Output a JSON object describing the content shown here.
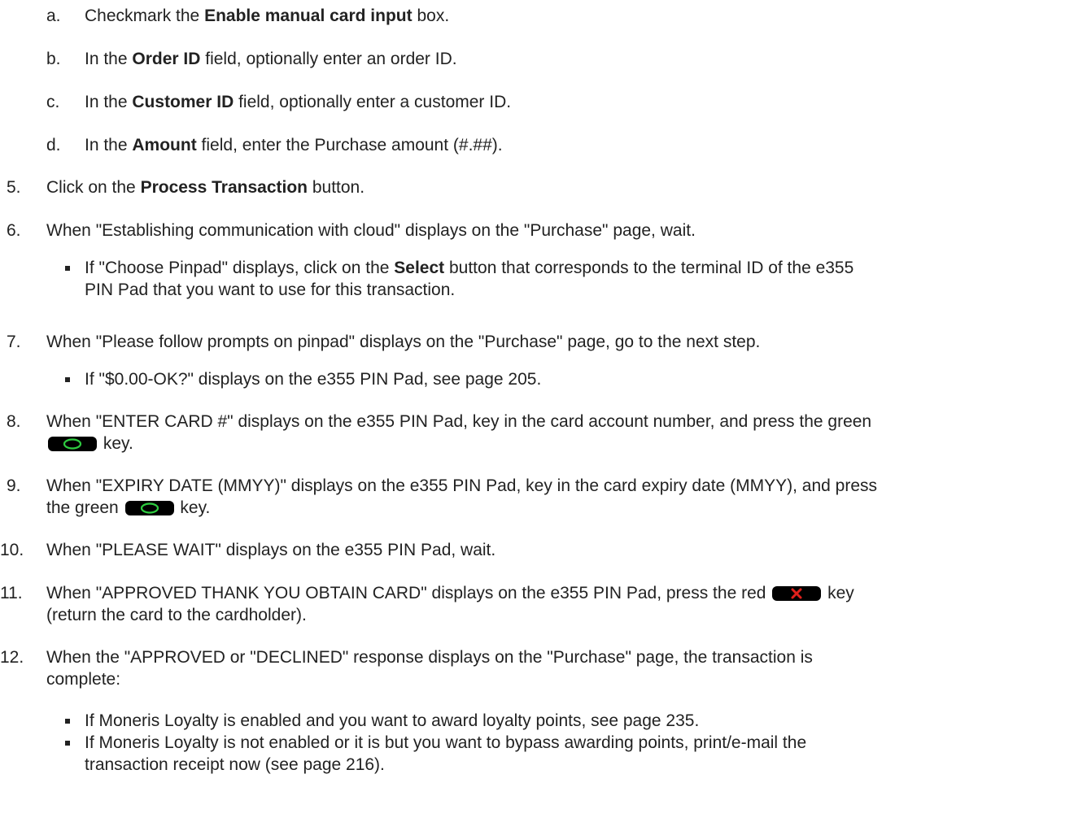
{
  "substeps": [
    {
      "marker": "a.",
      "pre": "Checkmark the ",
      "bold": "Enable manual card input",
      "post": " box."
    },
    {
      "marker": "b.",
      "pre": "In the ",
      "bold": "Order ID",
      "post": " field, optionally enter an order ID."
    },
    {
      "marker": "c.",
      "pre": "In the ",
      "bold": "Customer ID",
      "post": " field, optionally enter a customer ID."
    },
    {
      "marker": "d.",
      "pre": "In the ",
      "bold": "Amount",
      "post": " field, enter the Purchase amount (#.##)."
    }
  ],
  "step5": {
    "marker": "5.",
    "pre": "Click on the ",
    "bold": "Process Transaction",
    "post": " button."
  },
  "step6": {
    "marker": "6.",
    "text": "When \"Establishing communication with cloud\" displays on the \"Purchase\" page, wait."
  },
  "step6_bullet": {
    "l1_pre": "If \"Choose Pinpad\" displays, click on the ",
    "l1_bold": "Select",
    "l1_post": " button that corresponds to the terminal ID of the e355",
    "l2": "PIN Pad that you want to use for this transaction."
  },
  "step7": {
    "marker": "7.",
    "text": "When \"Please follow prompts on pinpad\" displays on the \"Purchase\" page, go to the next step."
  },
  "step7_bullet": {
    "text": "If \"$0.00-OK?\" displays on the e355 PIN Pad, see page 205."
  },
  "step8": {
    "marker": "8.",
    "l1": "When \"ENTER CARD #\" displays on the e355 PIN Pad, key in the card account number, and press the green",
    "l2": " key."
  },
  "step9": {
    "marker": "9.",
    "l1": "When \"EXPIRY DATE (MMYY)\" displays on the e355 PIN Pad, key in the card expiry date (MMYY), and press",
    "l2_pre": "the green ",
    "l2_post": " key."
  },
  "step10": {
    "marker": "10.",
    "text": "When \"PLEASE WAIT\" displays on the e355 PIN Pad, wait."
  },
  "step11": {
    "marker": "11.",
    "l1_pre": "When \"APPROVED THANK YOU OBTAIN CARD\" displays on the e355 PIN Pad, press the red ",
    "l1_post": " key",
    "l2": "(return the card to the cardholder)."
  },
  "step12": {
    "marker": "12.",
    "l1": "When the \"APPROVED or \"DECLINED\" response displays on the \"Purchase\" page, the transaction is",
    "l2": "complete:"
  },
  "step12_bullets": [
    {
      "l1": "If Moneris Loyalty is enabled and you want to award loyalty points, see page 235."
    },
    {
      "l1": "If Moneris Loyalty is not enabled or it is but you want to bypass awarding points, print/e-mail the",
      "l2": "transaction receipt now (see page 216)."
    }
  ],
  "icons": {
    "green_key": "green-ok-key-icon",
    "red_key": "red-cancel-key-icon"
  },
  "colors": {
    "green": "#2ecc40",
    "red": "#e0201b",
    "text": "#222222"
  }
}
